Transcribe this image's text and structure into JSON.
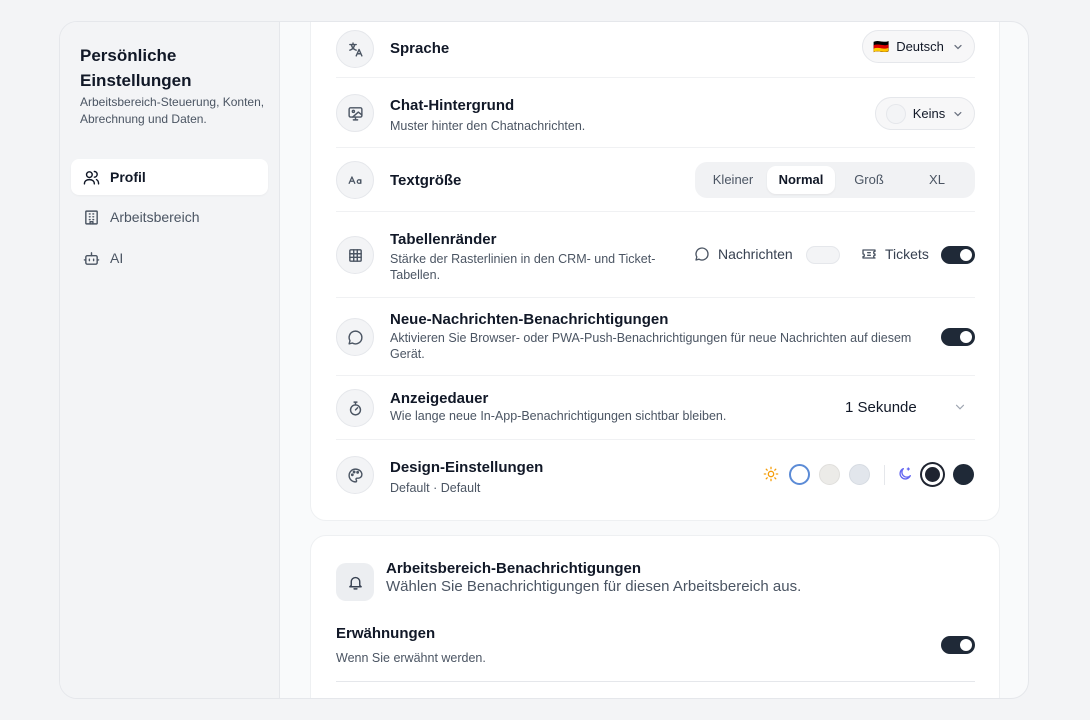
{
  "sidebar": {
    "title": "Persönliche Einstellungen",
    "subtitle": "Arbeitsbereich-Steuerung, Konten, Abrechnung und Daten.",
    "items": [
      {
        "label": "Profil",
        "icon": "users-icon",
        "active": true
      },
      {
        "label": "Arbeitsbereich",
        "icon": "building-icon",
        "active": false
      },
      {
        "label": "AI",
        "icon": "bot-icon",
        "active": false
      }
    ]
  },
  "settings": {
    "language": {
      "title": "Sprache",
      "value": "Deutsch",
      "flag": "🇩🇪"
    },
    "chat_background": {
      "title": "Chat-Hintergrund",
      "desc": "Muster hinter den Chatnachrichten.",
      "value": "Keins"
    },
    "text_size": {
      "title": "Textgröße",
      "options": [
        "Kleiner",
        "Normal",
        "Groß",
        "XL"
      ],
      "selected": "Normal"
    },
    "table_borders": {
      "title": "Tabellenränder",
      "desc": "Stärke der Rasterlinien in den CRM- und Ticket-Tabellen.",
      "messages_label": "Nachrichten",
      "tickets_label": "Tickets",
      "messages_on": false,
      "tickets_on": true
    },
    "new_message_notifications": {
      "title": "Neue-Nachrichten-Benachrichtigungen",
      "desc": "Aktivieren Sie Browser- oder PWA-Push-Benachrichtigungen für neue Nachrichten auf diesem Gerät.",
      "on": true
    },
    "display_duration": {
      "title": "Anzeigedauer",
      "desc": "Wie lange neue In-App-Benachrichtigungen sichtbar bleiben.",
      "value": "1 Sekunde"
    },
    "design": {
      "title": "Design-Einstellungen",
      "desc": "Default · Default",
      "light_swatches": [
        "#ffffff",
        "#ecebe8",
        "#e2e6ec"
      ],
      "dark_swatches": [
        "#1f2430",
        "#1f2937"
      ]
    }
  },
  "workspace_notifications": {
    "title": "Arbeitsbereich-Benachrichtigungen",
    "desc": "Wählen Sie Benachrichtigungen für diesen Arbeitsbereich aus.",
    "mentions": {
      "title": "Erwähnungen",
      "desc": "Wenn Sie erwähnt werden.",
      "on": true
    }
  },
  "colors": {
    "accent_dark": "#1f2937",
    "sun": "#f59e0b",
    "moon": "#6366f1",
    "selected_ring": "#3b82f6"
  }
}
